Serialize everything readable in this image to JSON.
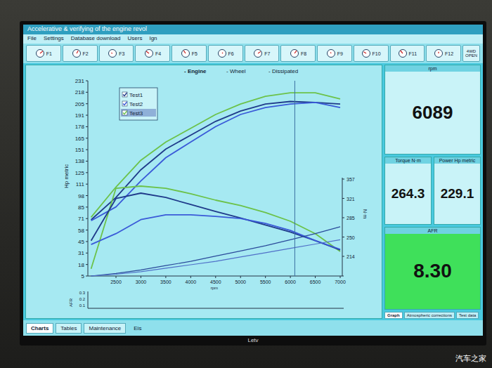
{
  "window": {
    "title": "Accelerative & verifying of the engine revol"
  },
  "menu": [
    "File",
    "Settings",
    "Database download",
    "Users",
    "Ign"
  ],
  "toolbar": [
    "F1",
    "F2",
    "F3",
    "F4",
    "F5",
    "F6",
    "F7",
    "F8",
    "F9",
    "F10",
    "F11",
    "F12"
  ],
  "drive": {
    "top": "4WD",
    "bottom": "OPEN"
  },
  "chart": {
    "header": [
      "- Engine",
      "- Wheel",
      "- Dissipated"
    ],
    "y_label": "Hp metric",
    "y_ticks": [
      "231",
      "218",
      "205",
      "191",
      "178",
      "165",
      "151",
      "138",
      "125",
      "111",
      "98",
      "85",
      "71",
      "58",
      "45",
      "31",
      "18",
      "5"
    ],
    "y2_label": "N·m",
    "y2_ticks": [
      "357",
      "321",
      "285",
      "250",
      "214"
    ],
    "x_label": "rpm",
    "x_ticks": [
      "2500",
      "3000",
      "3500",
      "4000",
      "4500",
      "5000",
      "5500",
      "6000",
      "6500",
      "7000"
    ],
    "rpm_points": [
      2000,
      2500,
      3000,
      3500,
      4000,
      4500,
      5000,
      5500,
      6000,
      6500,
      7000
    ],
    "legend": [
      {
        "label": "Test1",
        "checked": true,
        "selected": false,
        "color": "#1f3a8a"
      },
      {
        "label": "Test2",
        "checked": true,
        "selected": false,
        "color": "#3a5ad8"
      },
      {
        "label": "Test3",
        "checked": true,
        "selected": true,
        "color": "#6cc24a"
      }
    ],
    "series": [
      {
        "kind": "power",
        "color": "#6cc24a",
        "values": [
          73,
          108,
          139,
          160,
          176,
          192,
          204,
          213,
          217,
          217,
          210
        ]
      },
      {
        "kind": "power",
        "color": "#1f3a8a",
        "values": [
          70,
          96,
          128,
          152,
          168,
          184,
          196,
          204,
          207,
          206,
          204
        ]
      },
      {
        "kind": "power",
        "color": "#3a5ad8",
        "values": [
          69,
          85,
          115,
          142,
          160,
          178,
          192,
          200,
          204,
          206,
          200
        ]
      },
      {
        "kind": "torque",
        "color": "#6cc24a",
        "values": [
          191,
          340,
          344,
          340,
          330,
          318,
          308,
          295,
          279,
          256,
          223
        ]
      },
      {
        "kind": "torque",
        "color": "#1f3a8a",
        "values": [
          243,
          321,
          331,
          323,
          310,
          297,
          285,
          272,
          259,
          243,
          226
        ]
      },
      {
        "kind": "torque",
        "color": "#3a5ad8",
        "values": [
          236,
          256,
          282,
          291,
          291,
          288,
          284,
          275,
          262,
          243,
          227
        ]
      },
      {
        "kind": "dissipated",
        "color": "#2a4a9a",
        "values": [
          5,
          8,
          12,
          17,
          22,
          28,
          34,
          40,
          47,
          54,
          62
        ]
      },
      {
        "kind": "dissipated",
        "color": "#5070c8",
        "values": [
          5,
          7,
          10,
          14,
          18,
          22,
          27,
          32,
          37,
          42,
          47
        ]
      }
    ],
    "cursor_rpm": 6089,
    "afr": {
      "label": "AFR",
      "ticks": [
        "0.3",
        "0.2",
        "0.1"
      ]
    }
  },
  "readouts": {
    "rpm_label": "rpm",
    "rpm": "6089",
    "torque_label": "Torque N·m",
    "torque": "264.3",
    "power_label": "Power Hp metric",
    "power": "229.1",
    "afr_label": "AFR",
    "afr": "8.30"
  },
  "readout_tabs": [
    {
      "label": "Graph",
      "selected": true
    },
    {
      "label": "Atmospheric corrections",
      "selected": false
    },
    {
      "label": "Test data",
      "selected": false
    }
  ],
  "status": "Eis",
  "bottom_tabs": [
    {
      "label": "Charts",
      "selected": true
    },
    {
      "label": "Tables",
      "selected": false
    },
    {
      "label": "Maintenance",
      "selected": false
    }
  ],
  "brand": "Letv",
  "watermark": "汽车之家"
}
